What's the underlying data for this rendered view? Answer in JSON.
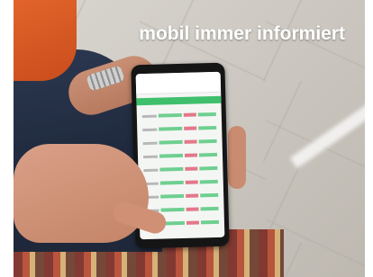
{
  "caption": "mobil immer informiert"
}
